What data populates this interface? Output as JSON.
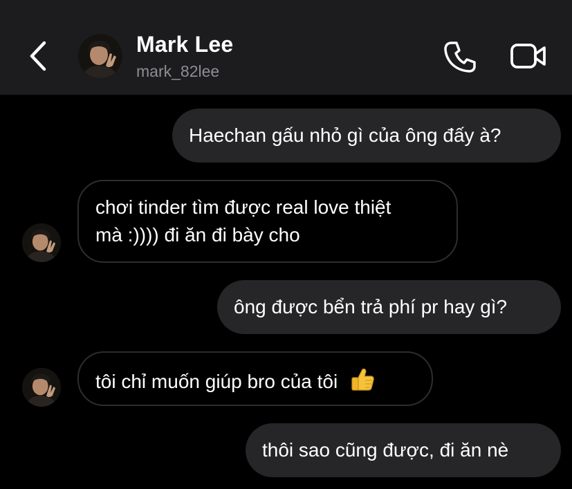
{
  "header": {
    "contact_name": "Mark Lee",
    "contact_handle": "mark_82lee",
    "back_icon": "chevron-left-icon",
    "call_icon": "phone-icon",
    "video_icon": "video-camera-icon"
  },
  "messages": [
    {
      "direction": "outgoing",
      "text": "Haechan gấu nhỏ gì của ông đấy à?"
    },
    {
      "direction": "incoming",
      "lines": [
        "chơi tinder tìm được real love thiệt",
        "mà :)))) đi ăn đi bày cho"
      ]
    },
    {
      "direction": "outgoing",
      "text": "ông được bển trả phí pr hay gì?"
    },
    {
      "direction": "incoming",
      "text": "tôi chỉ muốn giúp bro của tôi",
      "emoji": "thumbs-up-icon"
    },
    {
      "direction": "outgoing",
      "text": "thôi sao cũng được, đi ăn nè"
    }
  ],
  "colors": {
    "background": "#000000",
    "header_bg": "#1c1c1e",
    "outgoing_bubble": "#262628",
    "incoming_border": "#2e2e30",
    "handle_text": "#8e8e93"
  }
}
